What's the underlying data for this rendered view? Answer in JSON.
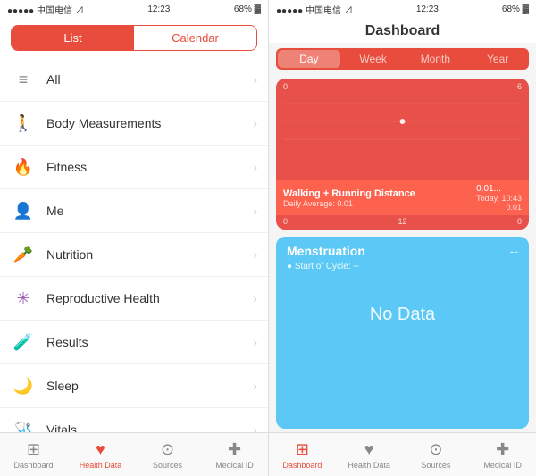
{
  "left": {
    "status": {
      "carrier": "●●●●● 中国电信 ⊿",
      "time": "12:23",
      "battery": "68% ▓"
    },
    "segment": {
      "list_label": "List",
      "calendar_label": "Calendar",
      "active": "list"
    },
    "items": [
      {
        "id": "all",
        "icon": "≡",
        "icon_color": "#888",
        "label": "All"
      },
      {
        "id": "body-measurements",
        "icon": "🚶",
        "icon_color": "#f39c12",
        "label": "Body Measurements"
      },
      {
        "id": "fitness",
        "icon": "🔥",
        "icon_color": "#e74c3c",
        "label": "Fitness"
      },
      {
        "id": "me",
        "icon": "👤",
        "icon_color": "#555",
        "label": "Me"
      },
      {
        "id": "nutrition",
        "icon": "🥕",
        "icon_color": "#e67e22",
        "label": "Nutrition"
      },
      {
        "id": "reproductive-health",
        "icon": "❄",
        "icon_color": "#9b59b6",
        "label": "Reproductive Health"
      },
      {
        "id": "results",
        "icon": "🧪",
        "icon_color": "#3498db",
        "label": "Results"
      },
      {
        "id": "sleep",
        "icon": "🌙",
        "icon_color": "#2980b9",
        "label": "Sleep"
      },
      {
        "id": "vitals",
        "icon": "💊",
        "icon_color": "#e74c3c",
        "label": "Vitals"
      }
    ],
    "tabs": [
      {
        "id": "dashboard",
        "icon": "⊞",
        "label": "Dashboard",
        "active": false
      },
      {
        "id": "health-data",
        "icon": "♥",
        "label": "Health Data",
        "active": true
      },
      {
        "id": "sources",
        "icon": "⊙",
        "label": "Sources",
        "active": false
      },
      {
        "id": "medical-id",
        "icon": "✚",
        "label": "Medical ID",
        "active": false
      }
    ]
  },
  "right": {
    "status": {
      "carrier": "●●●●● 中国电信 ⊿",
      "time": "12:23",
      "battery": "68% ▓"
    },
    "title": "Dashboard",
    "time_segments": [
      {
        "id": "day",
        "label": "Day",
        "active": true
      },
      {
        "id": "week",
        "label": "Week",
        "active": false
      },
      {
        "id": "month",
        "label": "Month",
        "active": false
      },
      {
        "id": "year",
        "label": "Year",
        "active": false
      }
    ],
    "chart": {
      "top_right_value": "6",
      "top_left_value": "0",
      "mid_left_value": "0",
      "bottom_left_value": "0",
      "mid_x_label": "12",
      "right_x_label": "0",
      "left_x_label": "0",
      "title": "Walking + Running Distance",
      "value": "0.01...",
      "daily_avg_label": "Daily Average: 0.01",
      "today_label": "Today, 10:43",
      "today_value": "0.01",
      "bottom_mid": "12",
      "bottom_right": "0"
    },
    "menstruation": {
      "title": "Menstruation",
      "dash": "--",
      "cycle_label": "● Start of Cycle: --",
      "no_data": "No Data"
    },
    "tabs": [
      {
        "id": "dashboard",
        "icon": "⊞",
        "label": "Dashboard",
        "active": true
      },
      {
        "id": "health-data",
        "icon": "♥",
        "label": "Health Data",
        "active": false
      },
      {
        "id": "sources",
        "icon": "⊙",
        "label": "Sources",
        "active": false
      },
      {
        "id": "medical-id",
        "icon": "✚",
        "label": "Medical ID",
        "active": false
      }
    ]
  }
}
